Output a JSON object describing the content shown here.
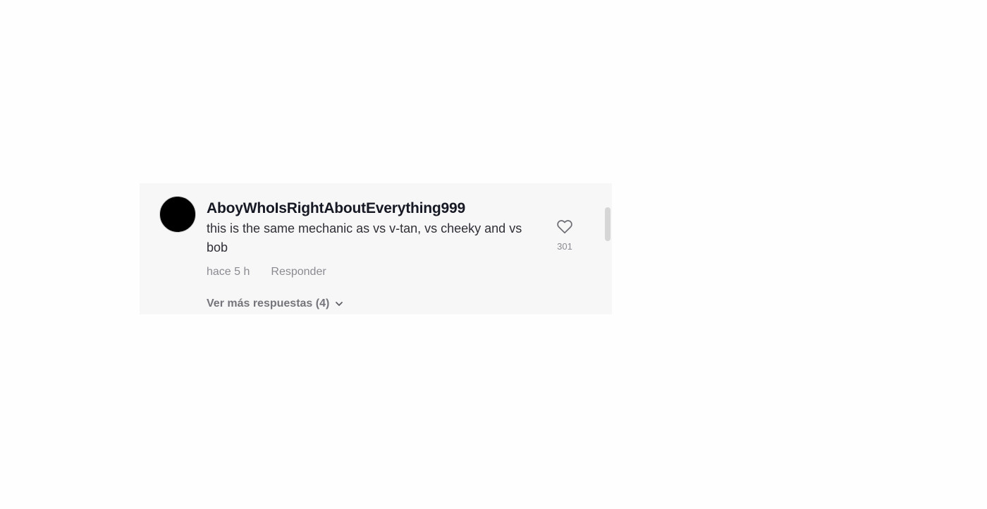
{
  "comment": {
    "username": "AboyWhoIsRightAboutEverything999",
    "text": "this is the same mechanic as vs v-tan, vs cheeky and vs bob",
    "timestamp": "hace 5 h",
    "reply_label": "Responder",
    "like_count": "301",
    "like_icon": "heart-outline-icon",
    "more_replies_label": "Ver más respuestas (4)",
    "more_replies_icon": "chevron-down-icon"
  },
  "colors": {
    "panel_background": "#f7f7f7",
    "username": "#161823",
    "secondary_text": "#8a8b91"
  }
}
